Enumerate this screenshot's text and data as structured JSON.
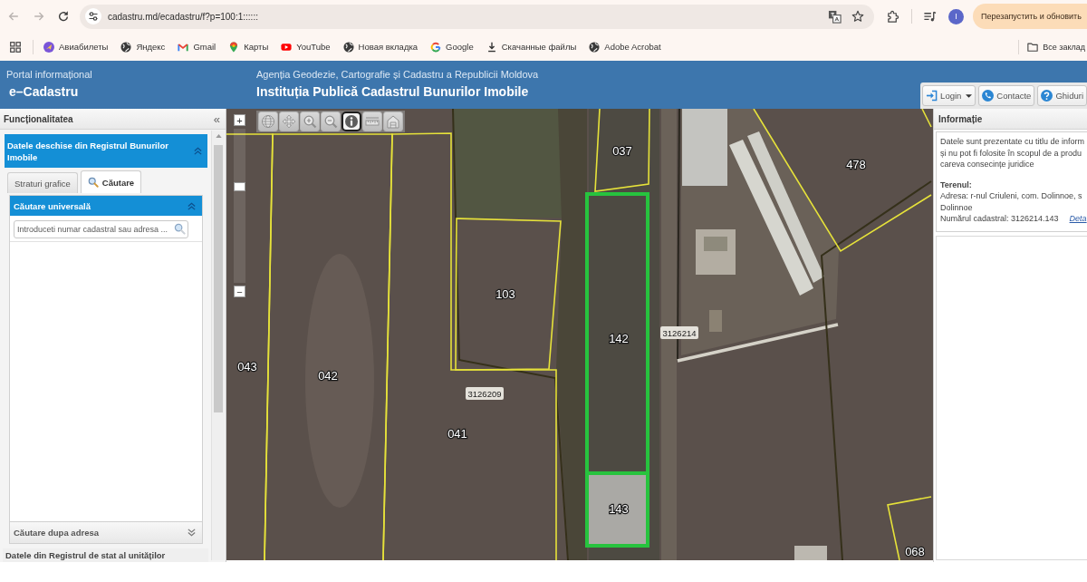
{
  "browser": {
    "back": {
      "disabled": true
    },
    "forward": {
      "disabled": true
    },
    "url": "cadastru.md/ecadastru/f?p=100:1::::::",
    "profile_initial": "I",
    "update_button": "Перезапустить и обновить",
    "bookmarks": [
      {
        "label": "Авиабилеты"
      },
      {
        "label": "Яндекс"
      },
      {
        "label": "Gmail"
      },
      {
        "label": "Карты"
      },
      {
        "label": "YouTube"
      },
      {
        "label": "Новая вкладка"
      },
      {
        "label": "Google"
      },
      {
        "label": "Скачанные файлы"
      },
      {
        "label": "Adobe Acrobat"
      }
    ],
    "all_bookmarks": "Все заклад"
  },
  "header": {
    "portal_label": "Portal informațional",
    "portal_name": "e–Cadastru",
    "agency": "Agenția Geodezie, Cartografie și Cadastru a Republicii Moldova",
    "institution": "Instituția Publică Cadastrul Bunurilor Imobile",
    "buttons": [
      {
        "label": "Login",
        "menu": true
      },
      {
        "label": "Contacte",
        "menu": false
      },
      {
        "label": "Ghiduri",
        "menu": false
      }
    ]
  },
  "left_panel": {
    "title": "Funcționalitatea",
    "collapse": "«",
    "section": {
      "title": "Datele deschise din Registrul Bunurilor Imobile",
      "expanded": true,
      "tabs": [
        {
          "label": "Straturi grafice",
          "selected": false
        },
        {
          "label": "Căutare",
          "selected": true
        }
      ],
      "panels": [
        {
          "title": "Căutare universală",
          "expanded": true,
          "search": {
            "placeholder": "Introduceti numar cadastral sau adresa ..."
          }
        },
        {
          "title": "Căutare dupa adresa",
          "expanded": false
        }
      ]
    },
    "next_section": {
      "title": "Datele din Registrul de stat al unităților"
    }
  },
  "map": {
    "zoom": {
      "in": "+",
      "out": "−",
      "level": 0.63
    },
    "tools": [
      {
        "selected": false
      },
      {
        "selected": false
      },
      {
        "selected": false
      },
      {
        "selected": false
      },
      {
        "selected": true
      },
      {
        "selected": false
      },
      {
        "selected": false
      }
    ],
    "parcels": [
      {
        "number": "043",
        "highlighted": false,
        "selected": false
      },
      {
        "number": "042",
        "highlighted": false,
        "selected": false
      },
      {
        "number": "103",
        "highlighted": false,
        "selected": false
      },
      {
        "number": "041",
        "highlighted": false,
        "selected": false
      },
      {
        "number": "037",
        "highlighted": false,
        "selected": false
      },
      {
        "number": "142",
        "highlighted": true,
        "selected": false
      },
      {
        "number": "143",
        "highlighted": true,
        "selected": true
      },
      {
        "number": "478",
        "highlighted": false,
        "selected": false
      },
      {
        "number": "068",
        "highlighted": false,
        "selected": false
      }
    ],
    "sectors": [
      {
        "number": "3126209"
      },
      {
        "number": "3126214"
      }
    ]
  },
  "info_panel": {
    "title": "Informație",
    "notice_lines": [
      "Datele sunt prezentate cu titlu de inform",
      "și nu pot fi folosite în scopul de a produ",
      "careva consecințe juridice"
    ],
    "parcel_heading": "Terenul:",
    "address_lines": [
      "Adresa: r-nul Criuleni, com. Dolinnoe, s",
      "Dolinnoe"
    ],
    "cadastral": "Numărul cadastral: 3126214.143",
    "details_link": "Deta"
  }
}
